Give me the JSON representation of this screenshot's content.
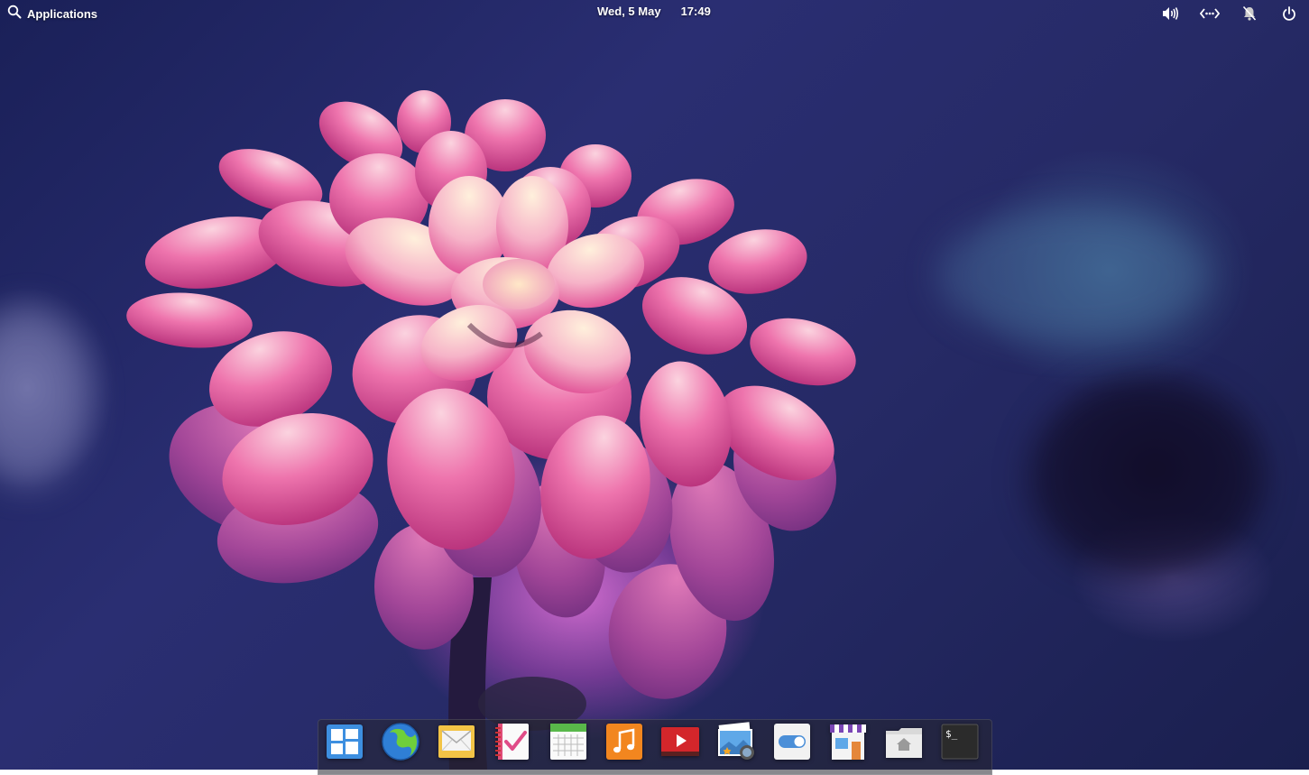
{
  "panel": {
    "applications_label": "Applications",
    "date": "Wed, 5 May",
    "time": "17:49",
    "indicators": [
      "sound-icon",
      "network-icon",
      "notifications-off-icon",
      "power-icon"
    ]
  },
  "dock": {
    "apps": [
      {
        "icon": "multitasking-view-icon"
      },
      {
        "icon": "web-browser-icon"
      },
      {
        "icon": "mail-icon"
      },
      {
        "icon": "tasks-icon"
      },
      {
        "icon": "calendar-icon"
      },
      {
        "icon": "music-icon"
      },
      {
        "icon": "videos-icon"
      },
      {
        "icon": "photos-icon"
      },
      {
        "icon": "system-settings-icon"
      },
      {
        "icon": "appcenter-icon"
      },
      {
        "icon": "files-icon"
      },
      {
        "icon": "terminal-icon"
      }
    ],
    "terminal_prompt": "$_"
  },
  "colors": {
    "wallpaper_base": "#262a66",
    "flower_pink": "#e0468f",
    "flower_center": "#f7d6b0"
  }
}
